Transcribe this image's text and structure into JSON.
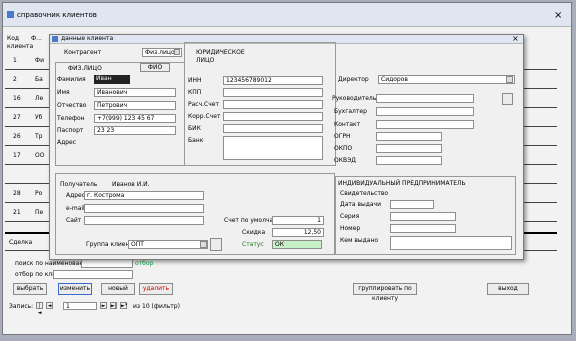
{
  "main_window": {
    "title": "справочник клиентов",
    "close_glyph": "×",
    "grid": {
      "header_col1": "Код клиента",
      "header_col2": "Ф...",
      "row_codes": [
        "1",
        "2",
        "16",
        "27",
        "26",
        "17",
        "",
        "28",
        "21",
        ""
      ],
      "row_snippets": [
        "Фи",
        "Ба",
        "Ле",
        "Уб",
        "Тр",
        "ОО",
        "",
        "Ро",
        "Пе",
        ""
      ],
      "selected_row_label": "Сделка"
    },
    "search_label": "поиск по наименованию",
    "search_button": "отбор",
    "filter_label": "отбор по клиенту",
    "buttons": {
      "btn1": "выбрать",
      "btn2": "изменить",
      "btn3": "новый",
      "btn4": "удалить",
      "btn5": "группировать по клиенту",
      "btn6": "выход"
    },
    "record_nav": {
      "label": "Запись:",
      "first": "|◄",
      "prev": "◄",
      "current": "1",
      "next": "►",
      "last": "►|",
      "new": "►*",
      "of_text": "из 10 (фильтр)"
    }
  },
  "dialog": {
    "title": "данные клиента",
    "close_glyph": "×",
    "client_label": "Контрагент",
    "type_value": "Физ.лицо",
    "fio_button": "ФИО",
    "fl_section": "ФИЗ.ЛИЦО",
    "fields_left": [
      {
        "label": "Фамилия",
        "value": "Иван"
      },
      {
        "label": "Имя",
        "value": "Иванович"
      },
      {
        "label": "Отчество",
        "value": "Петрович"
      },
      {
        "label": "Телефон",
        "value": "+7(999) 123 45 67"
      },
      {
        "label": "Паспорт",
        "value": "23 23"
      },
      {
        "label": "Адрес",
        "value": ""
      }
    ],
    "ul_section": "ЮРИДИЧЕСКОЕ ЛИЦО",
    "fields_mid": [
      {
        "label": "ИНН",
        "value": "123456789012"
      },
      {
        "label": "КПП",
        "value": ""
      },
      {
        "label": "Расч.Счет",
        "value": ""
      },
      {
        "label": "Корр.Счет",
        "value": ""
      },
      {
        "label": "БИК",
        "value": ""
      },
      {
        "label": "Банк",
        "value": ""
      }
    ],
    "right_top": {
      "director_label": "Директор",
      "director_value": "Сидоров",
      "position_label": "Руководитель",
      "accountant_label": "Бухгалтер",
      "contact_label": "Контакт",
      "ogrn_label": "ОГРН",
      "okpo_label": "ОКПО",
      "okved_label": "ОКВЭД"
    },
    "bottom_left": {
      "delivery_label": "Получатель",
      "delivery_value": "Иванов И.И.",
      "address_label": "Адрес",
      "address_value": "г. Кострома",
      "email_label": "e-mail",
      "site_label": "Сайт",
      "count_label": "Счет по умолчанию",
      "count_value": "1",
      "discount_label": "Скидка",
      "discount_value": "12,50",
      "group_label": "Группа клиентов",
      "group_value": "ОПТ",
      "status_label": "Статус",
      "status_value": "ОК"
    },
    "ip_section": {
      "title": "ИНДИВИДУАЛЬНЫЙ ПРЕДПРИНИМАТЕЛЬ",
      "cert_label": "Свидетельство",
      "date_label": "Дата выдачи",
      "series_label": "Серия",
      "number_label": "Номер",
      "issued_label": "Кем выдано"
    }
  }
}
